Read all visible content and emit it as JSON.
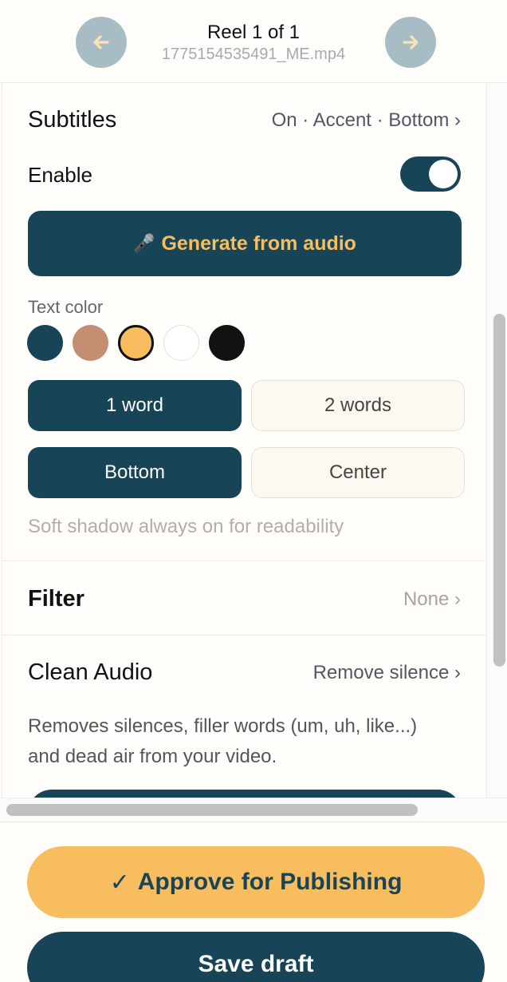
{
  "header": {
    "title": "Reel 1 of 1",
    "filename": "1775154535491_ME.mp4",
    "prev_icon": "arrow-left-icon",
    "next_icon": "arrow-right-icon"
  },
  "subtitles": {
    "title": "Subtitles",
    "summary": "On · Accent · Bottom ›",
    "enable_label": "Enable",
    "enabled": true,
    "generate_icon": "microphone-icon",
    "generate_emoji": "🎤",
    "generate_label": "Generate from audio",
    "text_color_label": "Text color",
    "colors": [
      "#174457",
      "#c48e73",
      "#f8bd5e",
      "#ffffff",
      "#121210"
    ],
    "selected_color_index": 2,
    "word_options": [
      "1 word",
      "2 words"
    ],
    "selected_word_option": "1 word",
    "position_options": [
      "Bottom",
      "Center"
    ],
    "selected_position_option": "Bottom",
    "hint": "Soft shadow always on for readability"
  },
  "filter": {
    "title": "Filter",
    "value": "None ›"
  },
  "clean_audio": {
    "title": "Clean Audio",
    "value": "Remove silence ›",
    "description": "Removes silences, filler words (um, uh, like...) and dead air from your video."
  },
  "footer": {
    "approve_icon": "checkmark-icon",
    "approve_check": "✓",
    "approve_label": "Approve for Publishing",
    "save_label": "Save draft"
  },
  "colors": {
    "primary": "#174457",
    "accent": "#f8bd5e",
    "nav_button": "#a7bcc4",
    "nav_arrow": "#fbe3b8"
  }
}
